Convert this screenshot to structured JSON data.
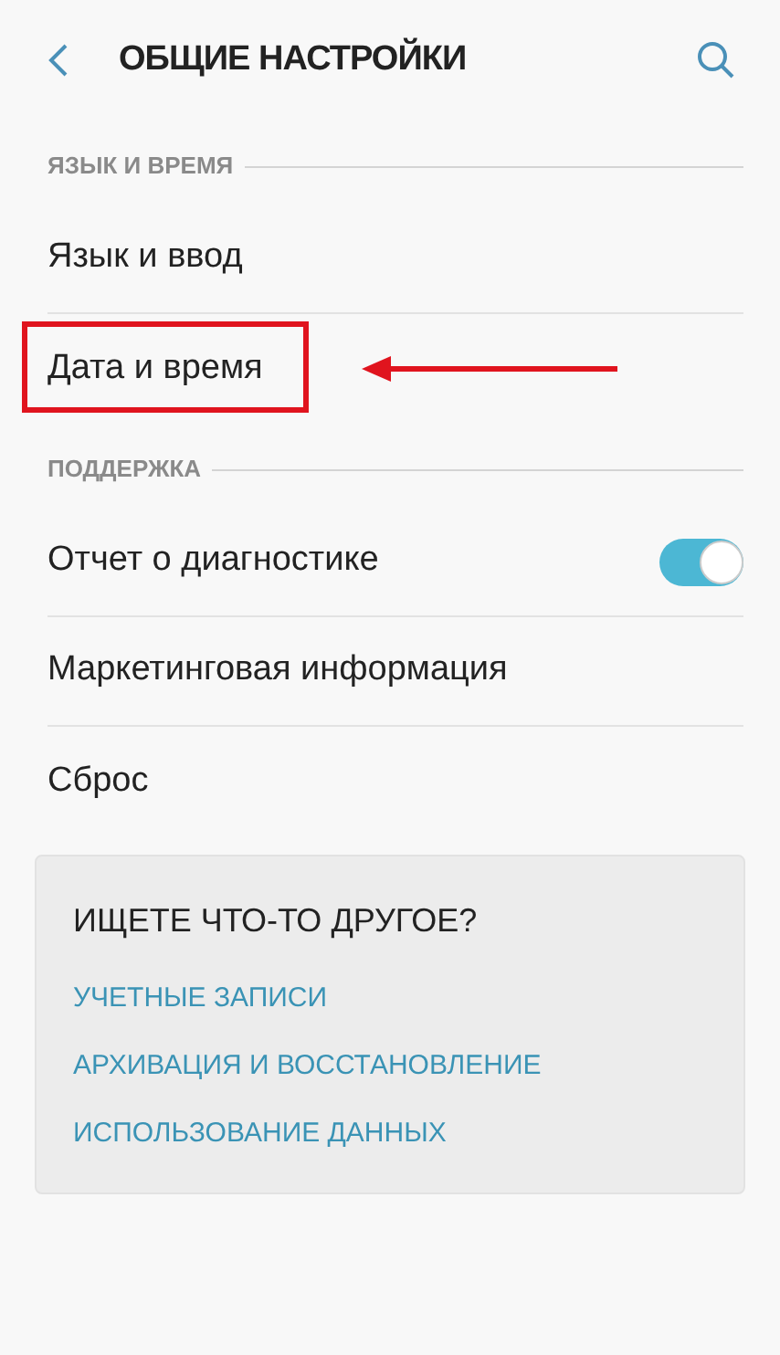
{
  "header": {
    "title": "ОБЩИЕ НАСТРОЙКИ"
  },
  "sections": [
    {
      "title": "ЯЗЫК И ВРЕМЯ",
      "items": [
        {
          "kind": "plain",
          "label": "Язык и ввод",
          "highlighted": false
        },
        {
          "kind": "plain",
          "label": "Дата и время",
          "highlighted": true
        }
      ]
    },
    {
      "title": "ПОДДЕРЖКА",
      "items": [
        {
          "kind": "toggle",
          "label": "Отчет о диагностике",
          "on": true,
          "highlighted": false
        },
        {
          "kind": "plain",
          "label": "Маркетинговая информация",
          "highlighted": false
        },
        {
          "kind": "plain",
          "label": "Сброс",
          "highlighted": false
        }
      ]
    }
  ],
  "card": {
    "title": "ИЩЕТЕ ЧТО-ТО ДРУГОЕ?",
    "links": [
      "УЧЕТНЫЕ ЗАПИСИ",
      "АРХИВАЦИЯ И ВОССТАНОВЛЕНИЕ",
      "ИСПОЛЬЗОВАНИЕ ДАННЫХ"
    ]
  }
}
